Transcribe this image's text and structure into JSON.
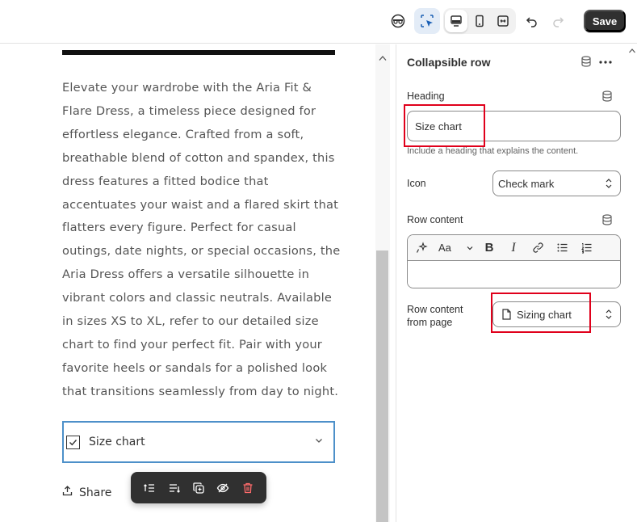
{
  "topbar": {
    "save_label": "Save"
  },
  "preview": {
    "description": "Elevate your wardrobe with the Aria Fit & Flare Dress, a timeless piece designed for effortless elegance. Crafted from a soft, breathable blend of cotton and spandex, this dress features a fitted bodice that accentuates your waist and a flared skirt that flatters every figure. Perfect for casual outings, date nights, or special occasions, the Aria Dress offers a versatile silhouette in vibrant colors and classic neutrals. Available in sizes XS to XL, refer to our detailed size chart to find your perfect fit. Pair with your favorite heels or sandals for a polished look that transitions seamlessly from day to night.",
    "collapsible_label": "Size chart",
    "share_label": "Share"
  },
  "panel": {
    "title": "Collapsible row",
    "heading_label": "Heading",
    "heading_value": "Size chart",
    "heading_helper": "Include a heading that explains the content.",
    "icon_label": "Icon",
    "icon_value": "Check mark",
    "row_content_label": "Row content",
    "rte_font_label": "Aa",
    "row_content_from_page_label_1": "Row content",
    "row_content_from_page_label_2": "from page",
    "row_content_from_page_value": "Sizing chart"
  },
  "colors": {
    "accent": "#303030",
    "highlight": "#e0001b",
    "selected_border": "#4d90c9"
  }
}
